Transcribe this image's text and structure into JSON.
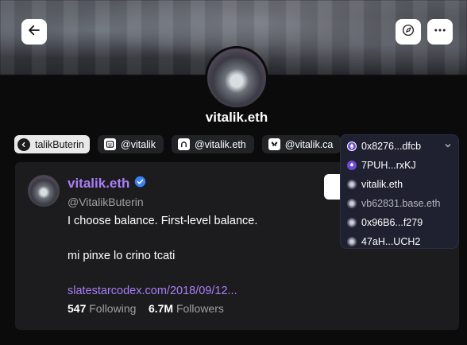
{
  "profile": {
    "display_name": "vitalik.eth"
  },
  "chips": [
    {
      "label": "talikButerin",
      "icon": "x-logo-icon"
    },
    {
      "label": "@vitalik",
      "icon": "farcaster-icon"
    },
    {
      "label": "@vitalik.eth",
      "icon": "lens-icon"
    },
    {
      "label": "@vitalik.ca",
      "icon": "bluesky-icon"
    }
  ],
  "dropdown": {
    "selected": "0x8276...dfcb",
    "items": [
      {
        "label": "7PUH...rxKJ",
        "icon": "solana-icon"
      },
      {
        "label": "vitalik.eth",
        "icon": "avatar-icon"
      },
      {
        "label": "vb62831.base.eth",
        "icon": "avatar-icon"
      },
      {
        "label": "0x96B6...f279",
        "icon": "avatar-icon"
      },
      {
        "label": "47aH...UCH2",
        "icon": "avatar-icon"
      }
    ]
  },
  "card": {
    "name": "vitalik.eth",
    "handle": "@VitalikButerin",
    "bio_line1": "I choose balance. First-level balance.",
    "bio_line2": "mi pinxe lo crino tcati",
    "link": "slatestarcodex.com/2018/09/12...",
    "following_count": "547",
    "following_label": "Following",
    "followers_count": "6.7M",
    "followers_label": "Followers"
  },
  "colors": {
    "accent": "#a97ef7",
    "verified": "#3b82f6",
    "card_bg": "#1c1c1e",
    "page_bg": "#0b0b0c"
  }
}
